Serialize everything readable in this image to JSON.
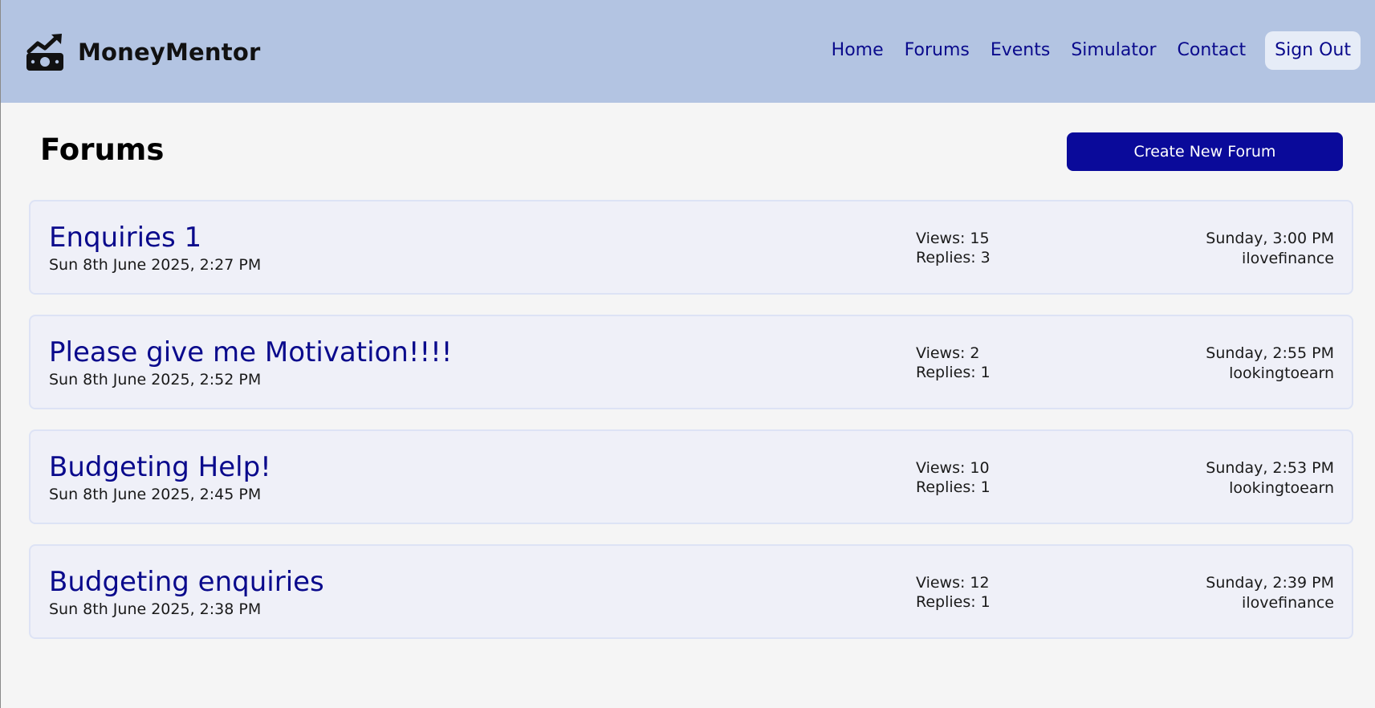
{
  "header": {
    "brand_name": "MoneyMentor",
    "brand_icon": "money-growth-icon",
    "nav": [
      {
        "label": "Home"
      },
      {
        "label": "Forums"
      },
      {
        "label": "Events"
      },
      {
        "label": "Simulator"
      },
      {
        "label": "Contact"
      },
      {
        "label": "Sign Out"
      }
    ]
  },
  "page": {
    "title": "Forums",
    "create_button_label": "Create New Forum"
  },
  "forums": [
    {
      "title": "Enquiries 1",
      "created": "Sun 8th June 2025, 2:27 PM",
      "views": "Views: 15",
      "replies": "Replies: 3",
      "last_post_time": "Sunday, 3:00 PM",
      "last_post_user": "ilovefinance"
    },
    {
      "title": "Please give me Motivation!!!!",
      "created": "Sun 8th June 2025, 2:52 PM",
      "views": "Views: 2",
      "replies": "Replies: 1",
      "last_post_time": "Sunday, 2:55 PM",
      "last_post_user": "lookingtoearn"
    },
    {
      "title": "Budgeting Help!",
      "created": "Sun 8th June 2025, 2:45 PM",
      "views": "Views: 10",
      "replies": "Replies: 1",
      "last_post_time": "Sunday, 2:53 PM",
      "last_post_user": "lookingtoearn"
    },
    {
      "title": "Budgeting enquiries",
      "created": "Sun 8th June 2025, 2:38 PM",
      "views": "Views: 12",
      "replies": "Replies: 1",
      "last_post_time": "Sunday, 2:39 PM",
      "last_post_user": "ilovefinance"
    }
  ],
  "colors": {
    "header_bg": "#b3c4e2",
    "accent": "#0a0a9a",
    "link": "#0a0a8c",
    "card_bg": "#eff0f8",
    "page_bg": "#f5f5f5"
  }
}
